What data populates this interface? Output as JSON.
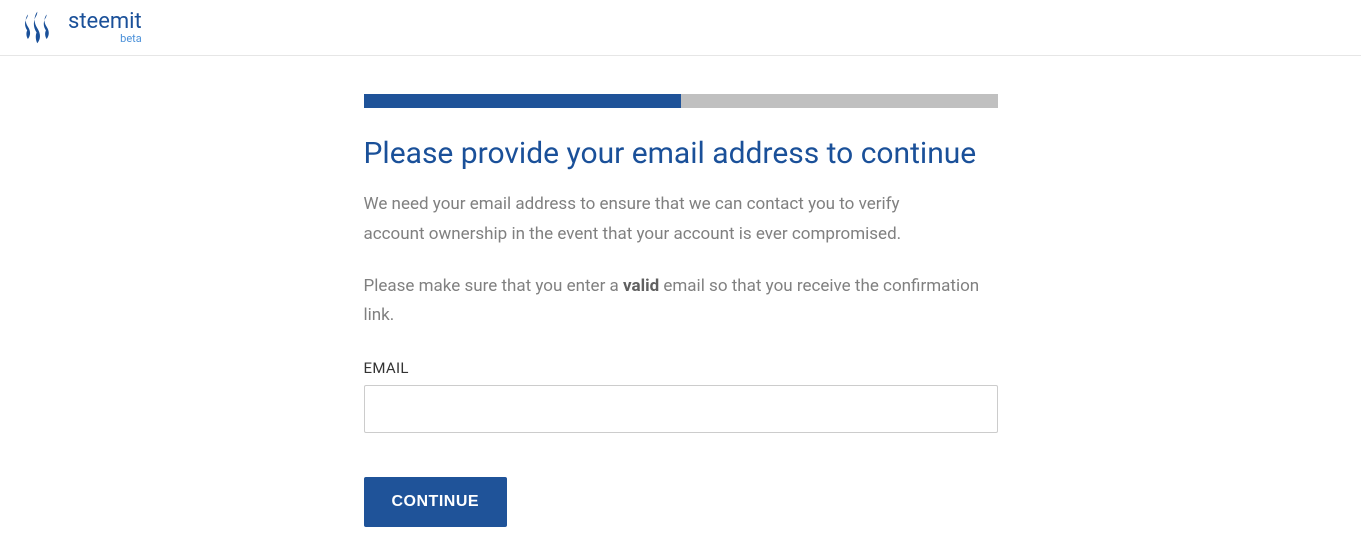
{
  "header": {
    "brand_name": "steemit",
    "brand_tag": "beta"
  },
  "progress": {
    "percent": 50
  },
  "form": {
    "heading": "Please provide your email address to continue",
    "description1": "We need your email address to ensure that we can contact you to verify account ownership in the event that your account is ever compromised.",
    "description2_pre": "Please make sure that you enter a ",
    "description2_bold": "valid",
    "description2_post": " email so that you receive the confirmation link.",
    "email_label": "EMAIL",
    "email_value": "",
    "continue_label": "CONTINUE"
  }
}
